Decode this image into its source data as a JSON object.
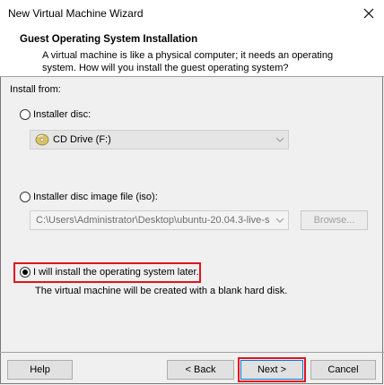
{
  "window": {
    "title": "New Virtual Machine Wizard"
  },
  "header": {
    "title": "Guest Operating System Installation",
    "description": "A virtual machine is like a physical computer; it needs an operating system. How will you install the guest operating system?"
  },
  "install_from": {
    "label": "Install from:",
    "options": [
      {
        "label": "Installer disc:",
        "selected": false
      },
      {
        "label": "Installer disc image file (iso):",
        "selected": false
      },
      {
        "label": "I will install the operating system later.",
        "selected": true
      }
    ],
    "disc_combo_value": "CD Drive (F:)",
    "iso_path": "C:\\Users\\Administrator\\Desktop\\ubuntu-20.04.3-live-s",
    "browse_label": "Browse...",
    "later_note": "The virtual machine will be created with a blank hard disk."
  },
  "footer": {
    "help_label": "Help",
    "back_label": "< Back",
    "next_label": "Next >",
    "cancel_label": "Cancel"
  },
  "colors": {
    "highlight": "#e0141e",
    "dialog_bg": "#f0f0f0",
    "header_bg": "#ffffff"
  },
  "icons": {
    "close": "close-icon",
    "disc": "cd-drive-icon",
    "dropdown": "chevron-down-icon"
  }
}
